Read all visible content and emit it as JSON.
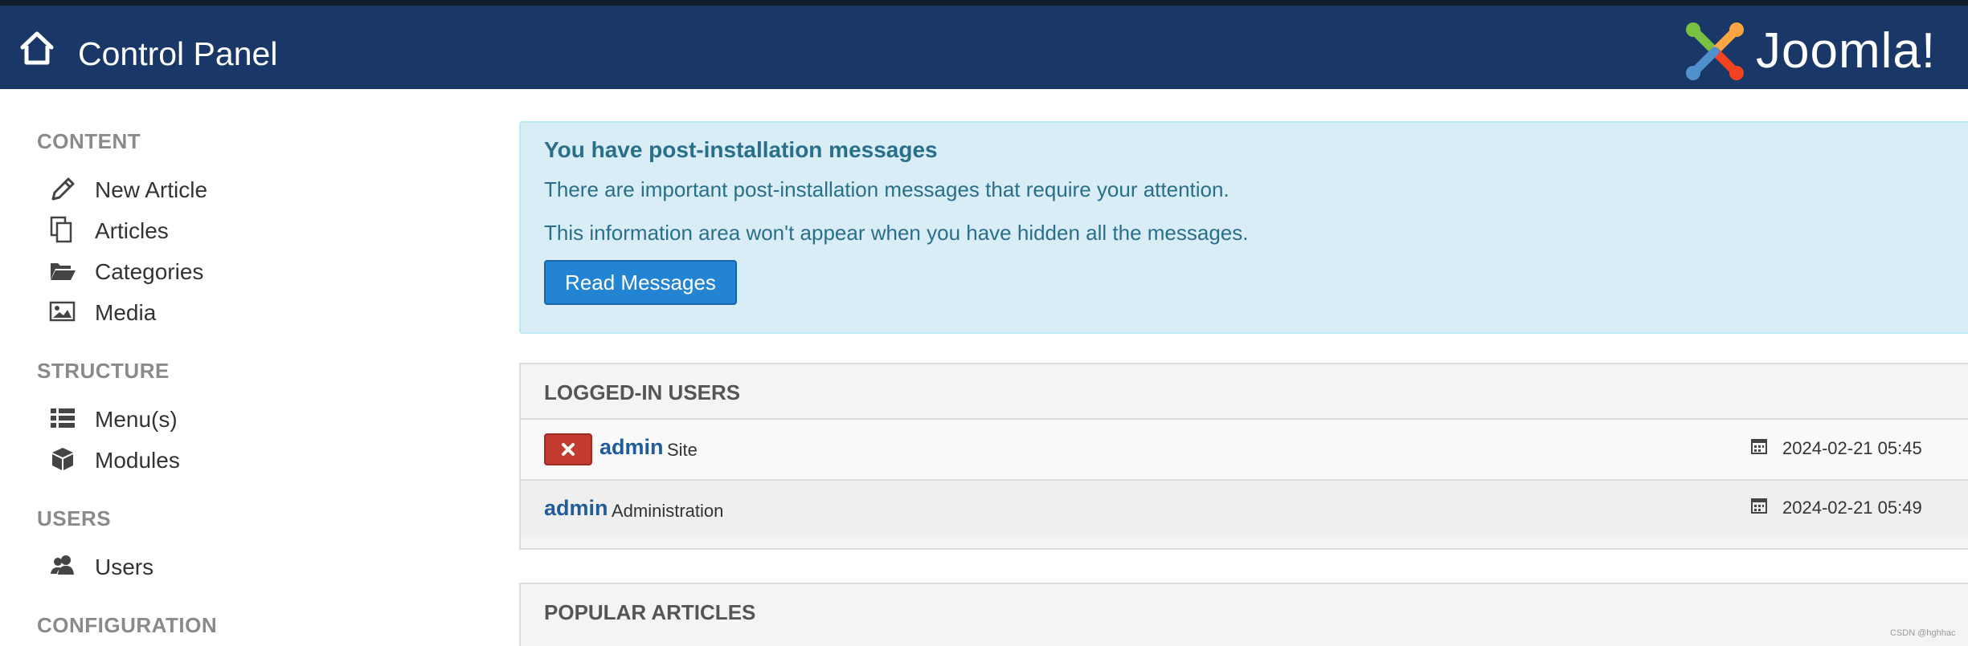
{
  "header": {
    "title": "Control Panel",
    "logo_text": "Joomla!"
  },
  "sidebar": {
    "sections": [
      {
        "title": "CONTENT",
        "items": [
          {
            "label": "New Article",
            "icon": "pencil-icon"
          },
          {
            "label": "Articles",
            "icon": "copy-icon"
          },
          {
            "label": "Categories",
            "icon": "folder-open-icon"
          },
          {
            "label": "Media",
            "icon": "image-icon"
          }
        ]
      },
      {
        "title": "STRUCTURE",
        "items": [
          {
            "label": "Menu(s)",
            "icon": "list-icon"
          },
          {
            "label": "Modules",
            "icon": "cube-icon"
          }
        ]
      },
      {
        "title": "USERS",
        "items": [
          {
            "label": "Users",
            "icon": "users-icon"
          }
        ]
      },
      {
        "title": "CONFIGURATION",
        "items": []
      }
    ]
  },
  "alert": {
    "heading": "You have post-installation messages",
    "line1": "There are important post-installation messages that require your attention.",
    "line2": "This information area won't appear when you have hidden all the messages.",
    "button": "Read Messages"
  },
  "logged_in_users": {
    "title": "LOGGED-IN USERS",
    "rows": [
      {
        "name": "admin",
        "context": "Site",
        "date": "2024-02-21 05:45"
      },
      {
        "name": "admin",
        "context": "Administration",
        "date": "2024-02-21 05:49"
      }
    ]
  },
  "popular_articles": {
    "title": "POPULAR ARTICLES"
  },
  "watermark": "CSDN @hghhac",
  "colors": {
    "header_bg": "#1a3867",
    "alert_bg": "#d9edf7",
    "primary_button": "#2384d3",
    "danger_button": "#c23b2e",
    "link": "#1f5c99"
  }
}
